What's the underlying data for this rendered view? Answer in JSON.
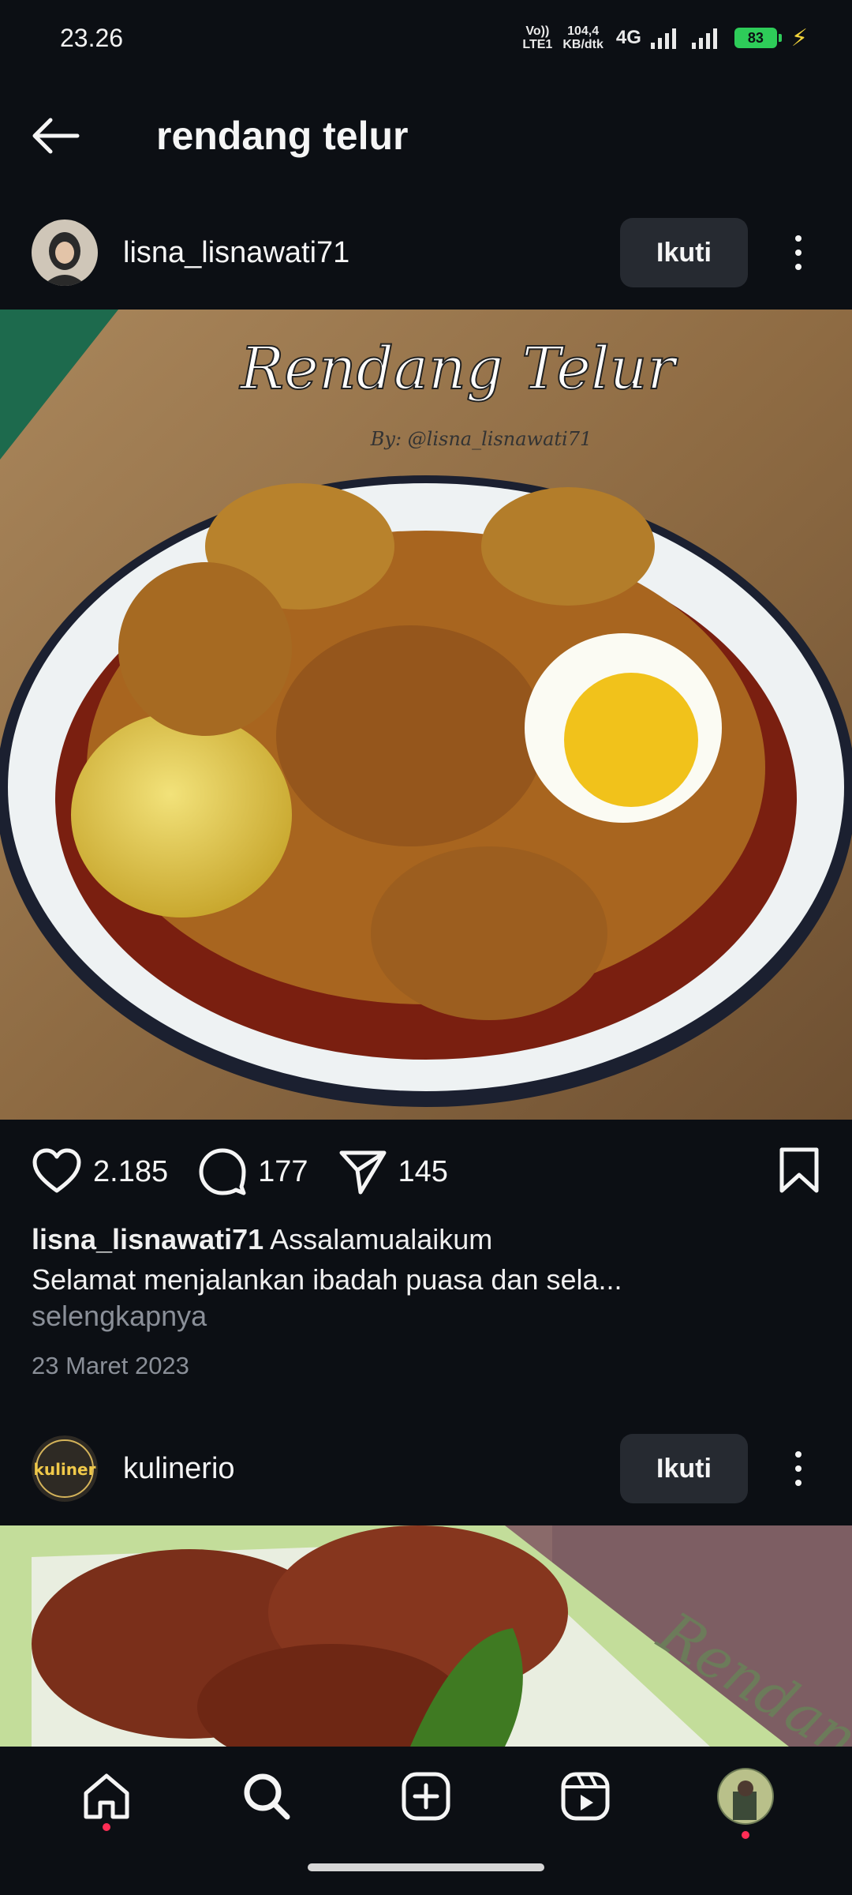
{
  "status_bar": {
    "time": "23.26",
    "volte": "Vo)) LTE1",
    "speed_value": "104,4",
    "speed_unit": "KB/dtk",
    "network": "4G",
    "battery": "83"
  },
  "header": {
    "title": "rendang telur",
    "back_icon": "arrow-left-icon"
  },
  "posts": [
    {
      "username": "lisna_lisnawati71",
      "follow_label": "Ikuti",
      "image_overlay_title": "Rendang Telur",
      "image_overlay_credit": "By: @lisna_lisnawati71",
      "likes": "2.185",
      "comments": "177",
      "shares": "145",
      "caption_user": "lisna_lisnawati71",
      "caption_text": "Assalamualaikum",
      "caption_line2": "Selamat menjalankan ibadah puasa dan sela...",
      "more_label": "selengkapnya",
      "date": "23 Maret 2023"
    },
    {
      "username": "kulinerio",
      "follow_label": "Ikuti",
      "avatar_text": "kuliner",
      "image_overlay_title": "Rendang T"
    }
  ],
  "bottom_nav": {
    "items": [
      "home-icon",
      "search-icon",
      "create-icon",
      "reels-icon",
      "profile-avatar"
    ]
  },
  "colors": {
    "background": "#0c0f14",
    "button_bg": "#262a31",
    "secondary_text": "#8a8f98",
    "battery": "#2ecc59",
    "notification_dot": "#ff2d55"
  }
}
